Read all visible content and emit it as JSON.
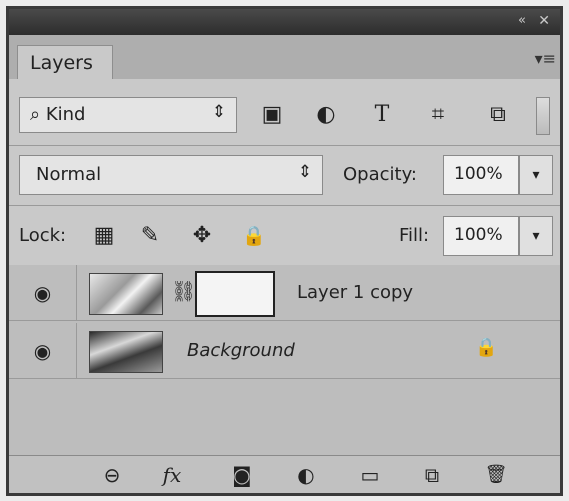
{
  "titlebar": {
    "collapse_glyph": "«",
    "close_glyph": "✕"
  },
  "panel": {
    "tab_label": "Layers",
    "menu_glyph": "▾≡"
  },
  "filter": {
    "kind_label": "Kind",
    "search_glyph": "⌕",
    "arrows_glyph": "⇕",
    "icons": [
      {
        "name": "image-icon",
        "glyph": "▣"
      },
      {
        "name": "adjustment-icon",
        "glyph": "◐"
      },
      {
        "name": "type-icon",
        "glyph": "T"
      },
      {
        "name": "shape-icon",
        "glyph": "⌗"
      },
      {
        "name": "smart-object-icon",
        "glyph": "⧉"
      }
    ]
  },
  "blend": {
    "mode": "Normal",
    "arrows_glyph": "⇕",
    "opacity_label": "Opacity:",
    "opacity_value": "100%",
    "drop_glyph": "▾"
  },
  "lock": {
    "label": "Lock:",
    "icons": [
      {
        "name": "lock-transparent-pixels-icon",
        "glyph": "▦"
      },
      {
        "name": "lock-image-pixels-icon",
        "glyph": "✎"
      },
      {
        "name": "lock-position-icon",
        "glyph": "✥"
      },
      {
        "name": "lock-all-icon",
        "glyph": "🔒"
      }
    ],
    "fill_label": "Fill:",
    "fill_value": "100%",
    "drop_glyph": "▾"
  },
  "layers": [
    {
      "name": "Layer 1 copy",
      "visible": true,
      "has_mask": true,
      "locked": false
    },
    {
      "name": "Background",
      "visible": true,
      "has_mask": false,
      "locked": true
    }
  ],
  "glyphs": {
    "eye": "◉",
    "chain": "⛓",
    "lock": "🔒"
  },
  "bottom_bar": [
    {
      "name": "link-layers-icon",
      "glyph": "⊖"
    },
    {
      "name": "fx-icon",
      "glyph": "fx"
    },
    {
      "name": "add-mask-icon",
      "glyph": "◙"
    },
    {
      "name": "adjustment-layer-icon",
      "glyph": "◐"
    },
    {
      "name": "group-folder-icon",
      "glyph": "▭"
    },
    {
      "name": "new-layer-icon",
      "glyph": "⧉"
    },
    {
      "name": "trash-icon",
      "glyph": "🗑"
    }
  ]
}
